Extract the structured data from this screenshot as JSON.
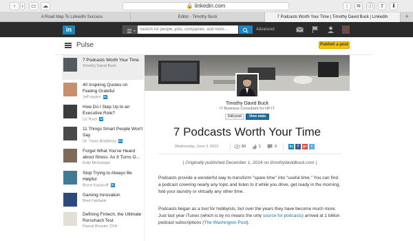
{
  "browser": {
    "url": "linkedin.com",
    "tabs": [
      {
        "title": "A Road Map To LinkedIn Success"
      },
      {
        "title": "Editor - Timothy Buck"
      },
      {
        "title": "7 Podcasts Worth Your Time | Timothy David Buck | LinkedIn"
      }
    ],
    "new_tab": "+"
  },
  "linkedin_nav": {
    "logo": "in",
    "search_placeholder": "Search for people, jobs, companies, and more...",
    "advanced_label": "Advanced",
    "icons": [
      "menu-icon",
      "search-icon",
      "mail-icon",
      "flag-icon",
      "person-icon",
      "avatar"
    ]
  },
  "pulse": {
    "title": "Pulse",
    "publish_label": "Publish a post"
  },
  "sidebar": {
    "items": [
      {
        "title": "7 Podcasts Worth Your Time",
        "author": "Timothy David Buck",
        "influencer": false,
        "selected": true,
        "thumb": "#555a60"
      },
      {
        "title": "40 Inspiring Quotes on Feeling Grateful",
        "author": "Jeff Haden",
        "influencer": true,
        "selected": false,
        "thumb": "#c98f6a"
      },
      {
        "title": "How Do I Step Up to an Executive Role?",
        "author": "Liz Ryan",
        "influencer": true,
        "selected": false,
        "thumb": "#3d3d3d"
      },
      {
        "title": "11 Things Smart People Won't Say",
        "author": "Dr. Travis Bradberry",
        "influencer": true,
        "selected": false,
        "thumb": "#4a4a4a"
      },
      {
        "title": "Forget What You've Heard about Stress. As It Turns O...",
        "author": "Kelly McGonigal",
        "influencer": false,
        "selected": false,
        "thumb": "#7c6a5c"
      },
      {
        "title": "Stop Trying to Always Be Helpful",
        "author": "Bruce Kasanoff",
        "influencer": true,
        "selected": false,
        "thumb": "#3f7b96"
      },
      {
        "title": "Gaming Innovation",
        "author": "Brett Fairbank",
        "influencer": false,
        "selected": false,
        "thumb": "#2c4a7a"
      },
      {
        "title": "Defining Fintech, the Ultimate Rorschach Test",
        "author": "Pascal Bouvier, CFA",
        "influencer": false,
        "selected": false,
        "thumb": "#e3dfd4"
      }
    ]
  },
  "article": {
    "author_name": "Timothy David Buck",
    "author_title": "IT Business Consultant for HP IT",
    "edit_label": "Edit post",
    "stats_label": "View stats",
    "title": "7 Podcasts Worth Your Time",
    "date": "Wednesday, June 3, 2015",
    "views": "50",
    "likes": "1",
    "comments": "2",
    "share_icons": [
      {
        "name": "linkedin-share-icon",
        "glyph": "in",
        "color": "#1a86c6"
      },
      {
        "name": "facebook-share-icon",
        "glyph": "f",
        "color": "#3b5998"
      },
      {
        "name": "google-plus-share-icon",
        "glyph": "g+",
        "color": "#dd4b39"
      },
      {
        "name": "twitter-share-icon",
        "glyph": "t",
        "color": "#55acee"
      }
    ],
    "quote": "| Originally published December 1, 2014 on timothydavidbuck.com |",
    "para1": "Podcasts provide a wonderful way to transform \"spare time\" into \"useful time.\" You can find a podcast covering nearly any topic and listen to it while you drive, get ready in the morning, fold your laundry or virtually any other time.",
    "para2_a": "Podcasts began as a tool for hobbyists, but over the years they have become much more. Just last year iTunes (which is by no means the only ",
    "para2_link1": "source for podcasts",
    "para2_b": ") arrived at 1 billion podcast subscriptions (",
    "para2_link2": "The Washington Post",
    "para2_c": ")."
  },
  "colors": {
    "linkedin_blue": "#1a86c6",
    "nav_bg": "#2b2b2b",
    "publish_yellow": "#f4c400",
    "stats_blue": "#1f6ea3"
  }
}
